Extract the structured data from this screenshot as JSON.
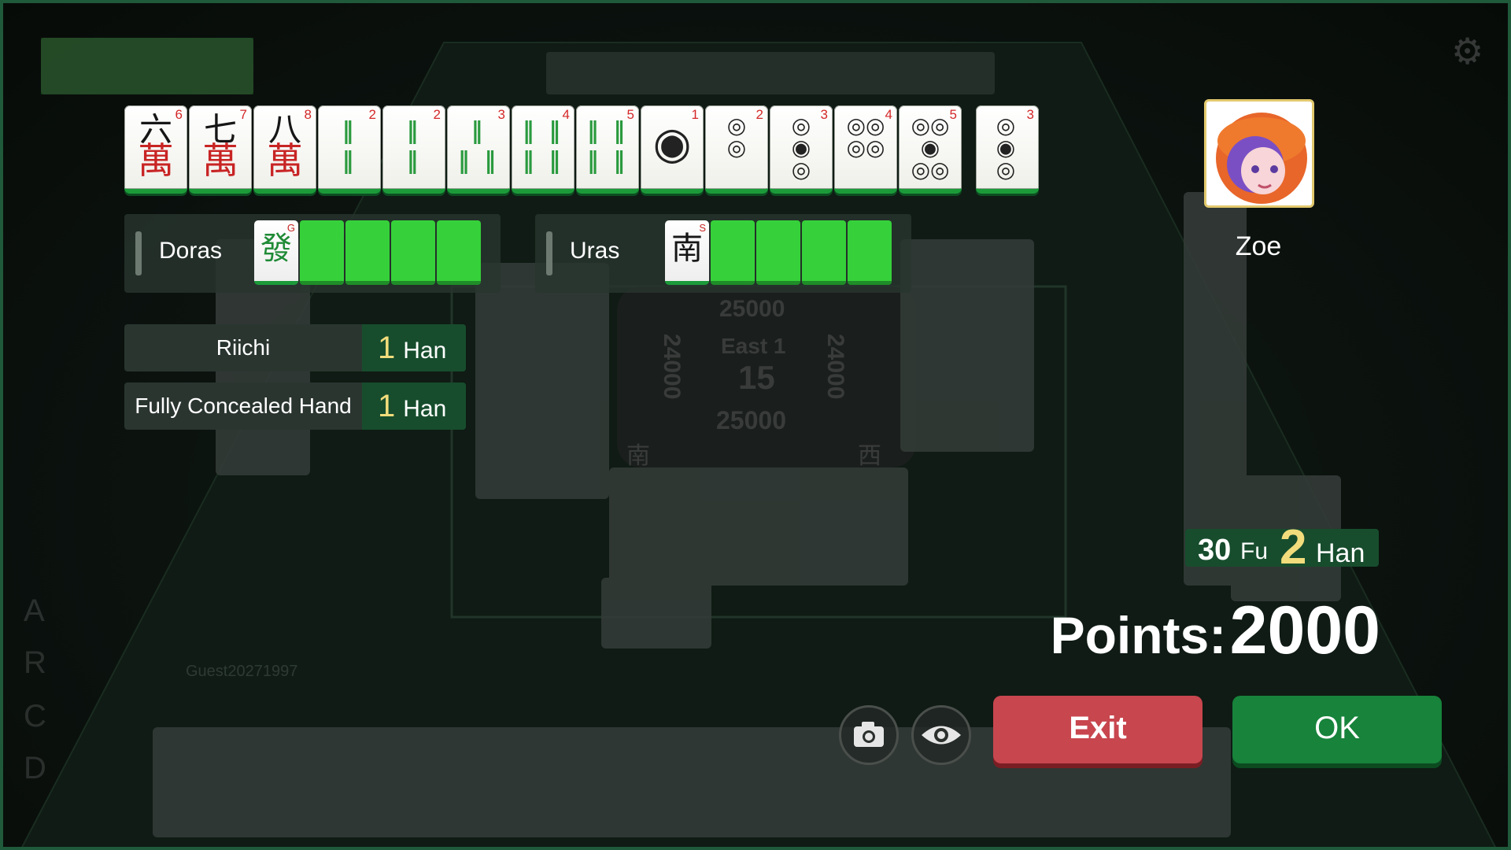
{
  "result": {
    "hand": [
      {
        "glyph": "六",
        "suit": "萬",
        "number": "6",
        "kind": "man"
      },
      {
        "glyph": "七",
        "suit": "萬",
        "number": "7",
        "kind": "man"
      },
      {
        "glyph": "八",
        "suit": "萬",
        "number": "8",
        "kind": "man"
      },
      {
        "glyph": "‖\n‖",
        "number": "2",
        "kind": "sou"
      },
      {
        "glyph": "‖\n‖",
        "number": "2",
        "kind": "sou"
      },
      {
        "glyph": "‖\n‖ ‖",
        "number": "3",
        "kind": "sou"
      },
      {
        "glyph": "‖ ‖\n‖ ‖",
        "number": "4",
        "kind": "sou"
      },
      {
        "glyph": "‖ ‖\n‖ ‖",
        "number": "5",
        "kind": "sou"
      },
      {
        "glyph": "◉",
        "number": "1",
        "kind": "pin"
      },
      {
        "glyph": "◎\n◎",
        "number": "2",
        "kind": "pin"
      },
      {
        "glyph": "◎\n◉\n◎",
        "number": "3",
        "kind": "pin"
      },
      {
        "glyph": "◎◎\n◎◎",
        "number": "4",
        "kind": "pin"
      },
      {
        "glyph": "◎◎\n◉\n◎◎",
        "number": "5",
        "kind": "pin"
      }
    ],
    "winning_tile": {
      "glyph": "◎\n◉\n◎",
      "number": "3",
      "kind": "pin"
    },
    "doras": {
      "label": "Doras",
      "tile_glyph": "發",
      "tile_letter": "G",
      "hidden_count": 4
    },
    "uras": {
      "label": "Uras",
      "tile_glyph": "南",
      "tile_letter": "S",
      "hidden_count": 4
    },
    "yaku": [
      {
        "name": "Riichi",
        "han": "1",
        "unit": "Han"
      },
      {
        "name": "Fully Concealed Hand",
        "han": "1",
        "unit": "Han"
      }
    ],
    "fu_value": "30",
    "fu_label": "Fu",
    "han_value": "2",
    "han_label": "Han",
    "points_label": "Points:",
    "points_value": "2000"
  },
  "winner": {
    "name": "Zoe"
  },
  "table_bg": {
    "score_top": "25000",
    "score_left": "24000",
    "score_right": "24000",
    "score_bottom": "25000",
    "round": "East 1",
    "remaining": "15",
    "opponent_name": "Guest20271997",
    "seat_south": "南",
    "seat_west": "西",
    "letters": [
      "A",
      "R",
      "C",
      "D"
    ]
  },
  "buttons": {
    "exit": "Exit",
    "ok": "OK"
  },
  "icons": {
    "camera": "camera-icon",
    "eye": "eye-icon",
    "settings": "gear-icon"
  },
  "colors": {
    "exit_bg": "#c8464e",
    "ok_bg": "#17833b",
    "han_bg": "#174d2d",
    "tile_green": "#36d13a",
    "accent_gold": "#f2dc7c"
  }
}
